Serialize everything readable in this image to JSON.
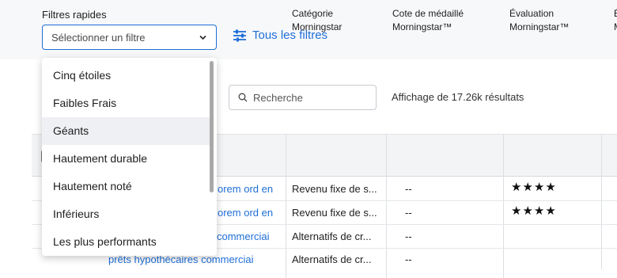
{
  "quick_filters": {
    "label": "Filtres rapides",
    "select_value": "Sélectionner un filtre",
    "all_filters_label": "Tous les filtres",
    "options": [
      "Cinq étoiles",
      "Faibles Frais",
      "Géants",
      "Hautement durable",
      "Hautement noté",
      "Inférieurs",
      "Les plus performants"
    ],
    "hovered_option": "Géants"
  },
  "search": {
    "placeholder": "Recherche"
  },
  "results_count": "Affichage de 17.26k résultats",
  "table": {
    "columns": [
      {
        "line1": "Catégorie",
        "line2": "Morningstar"
      },
      {
        "line1": "Cote de médaillé",
        "line2": "Morningstar™"
      },
      {
        "line1": "Évaluation",
        "line2": "Morningstar™"
      },
      {
        "line1": "É",
        "line2": "M"
      }
    ],
    "rows": [
      {
        "name": "orem ord en",
        "category": "Revenu fixe de s...",
        "medal": "--",
        "rating": "★★★★",
        "rating_stars": 4
      },
      {
        "name": "orem ord en",
        "category": "Revenu fixe de s...",
        "medal": "--",
        "rating": "★★★★",
        "rating_stars": 4
      },
      {
        "name": "commerciai",
        "category": "Alternatifs de cr...",
        "medal": "--",
        "rating": "",
        "rating_stars": 0
      },
      {
        "name": "prêts hypothécaires commerciai",
        "category": "Alternatifs de cr...",
        "medal": "--",
        "rating": "",
        "rating_stars": 0
      }
    ]
  },
  "colors": {
    "accent": "#1f6fd8",
    "header_bg": "#f3f4f6",
    "hover_bg": "#eef0f3"
  }
}
